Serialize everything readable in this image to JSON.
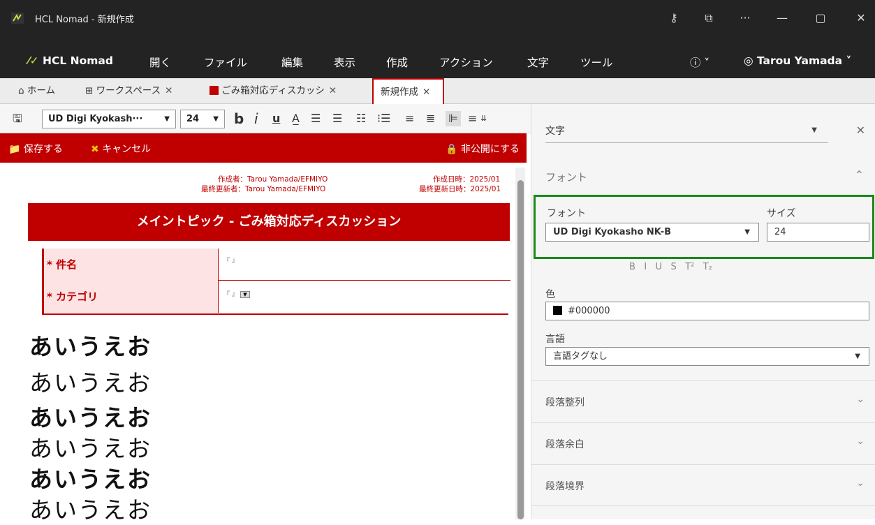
{
  "titlebar": {
    "title": "HCL Nomad - 新規作成"
  },
  "menu": {
    "brand": "HCL Nomad",
    "items": [
      "開く",
      "ファイル",
      "編集",
      "表示",
      "作成",
      "アクション",
      "文字",
      "ツール"
    ],
    "user": "Tarou Yamada"
  },
  "tabs": [
    {
      "label": "ホーム"
    },
    {
      "label": "ワークスペース"
    },
    {
      "label": "ごみ箱対応ディスカッシ"
    },
    {
      "label": "新規作成"
    }
  ],
  "toolbar": {
    "font": "UD Digi Kyokash···",
    "size": "24"
  },
  "actions": {
    "save": "保存する",
    "cancel": "キャンセル",
    "private": "非公開にする"
  },
  "meta": {
    "author": "作成者：Tarou Yamada/EFMIYO",
    "updater": "最終更新者：Tarou Yamada/EFMIYO",
    "created": "作成日時：2025/01",
    "updated": "最終更新日時：2025/01"
  },
  "form": {
    "title": "メイントピック - ごみ箱対応ディスカッション",
    "subject_label": "* 件名",
    "category_label": "* カテゴリ"
  },
  "body_lines": [
    "あいうえお",
    "あいうえお",
    "あいうえお",
    "あいうえお",
    "あいうえお",
    "あいうえお"
  ],
  "panel": {
    "dropdown": "文字",
    "font_section": "フォント",
    "font_label": "フォント",
    "size_label": "サイズ",
    "font_value": "UD Digi Kyokasho NK-B",
    "size_value": "24",
    "color_label": "色",
    "color_value": "#000000",
    "lang_label": "言語",
    "lang_value": "言語タグなし",
    "sections": [
      "段落整列",
      "段落余白",
      "段落境界"
    ]
  }
}
